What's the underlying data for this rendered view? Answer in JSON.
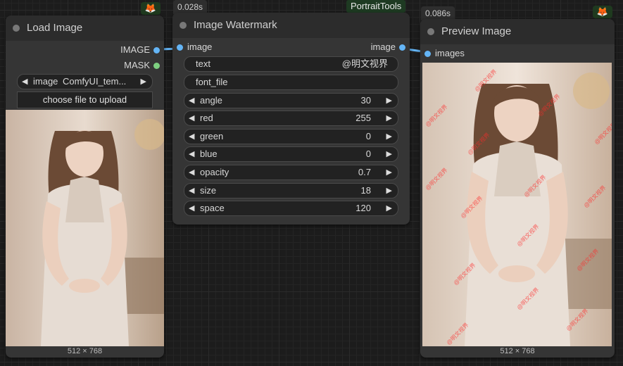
{
  "nodes": {
    "load_image": {
      "title": "Load Image",
      "outputs": [
        "IMAGE",
        "MASK"
      ],
      "image_widget": {
        "label": "image",
        "value": "ComfyUI_tem..."
      },
      "upload_label": "choose file to upload",
      "dimensions": "512 × 768"
    },
    "watermark": {
      "title": "Image Watermark",
      "time": "0.028s",
      "input": "image",
      "output": "image",
      "text_widget": {
        "label": "text",
        "value": "@明文视界"
      },
      "font_widget": {
        "label": "font_file",
        "value": ""
      },
      "params": [
        {
          "label": "angle",
          "value": "30"
        },
        {
          "label": "red",
          "value": "255"
        },
        {
          "label": "green",
          "value": "0"
        },
        {
          "label": "blue",
          "value": "0"
        },
        {
          "label": "opacity",
          "value": "0.7"
        },
        {
          "label": "size",
          "value": "18"
        },
        {
          "label": "space",
          "value": "120"
        }
      ]
    },
    "preview": {
      "title": "Preview Image",
      "time": "0.086s",
      "input": "images",
      "dimensions": "512 × 768"
    }
  },
  "tag": "PortraitTools",
  "badge_icon": "fox-icon",
  "colors": {
    "link": "#64b5f6",
    "mask_port": "#7dcf80",
    "watermark": "#ff2a2a",
    "tag_bg": "#1e3a22"
  }
}
